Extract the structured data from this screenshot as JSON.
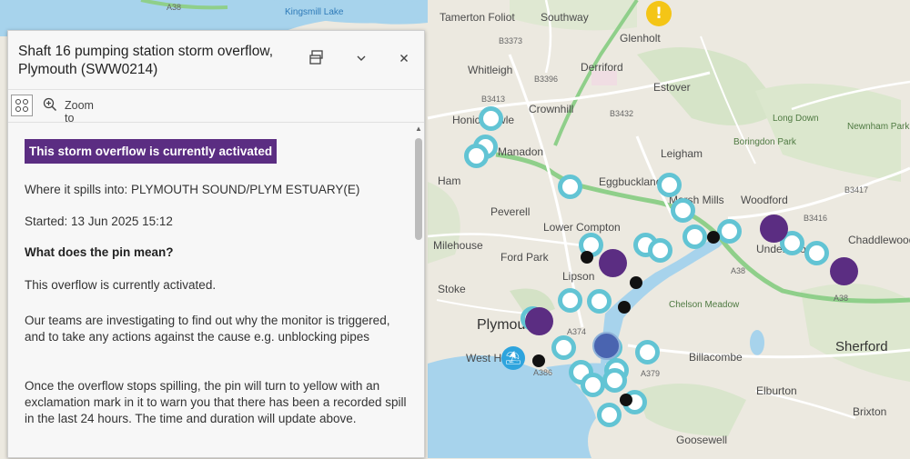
{
  "map": {
    "places": [
      {
        "key": "tamerton",
        "text": "Tamerton Foliot"
      },
      {
        "key": "southway",
        "text": "Southway"
      },
      {
        "key": "glenholt",
        "text": "Glenholt"
      },
      {
        "key": "whitleigh",
        "text": "Whitleigh"
      },
      {
        "key": "derriford",
        "text": "Derriford"
      },
      {
        "key": "estover",
        "text": "Estover"
      },
      {
        "key": "crownhill",
        "text": "Crownhill"
      },
      {
        "key": "honicknowle",
        "text": "Honicknowle"
      },
      {
        "key": "manadon",
        "text": "Manadon"
      },
      {
        "key": "leigham",
        "text": "Leigham"
      },
      {
        "key": "ham",
        "text": "Ham"
      },
      {
        "key": "eggbuckland",
        "text": "Eggbuckland"
      },
      {
        "key": "peverell",
        "text": "Peverell"
      },
      {
        "key": "lower_compton",
        "text": "Lower Compton"
      },
      {
        "key": "marsh_mills",
        "text": "Marsh Mills"
      },
      {
        "key": "woodford",
        "text": "Woodford"
      },
      {
        "key": "milehouse",
        "text": "Milehouse"
      },
      {
        "key": "ford_park",
        "text": "Ford Park"
      },
      {
        "key": "lipson",
        "text": "Lipson"
      },
      {
        "key": "underwood",
        "text": "Underwood"
      },
      {
        "key": "chaddlewood",
        "text": "Chaddlewood"
      },
      {
        "key": "stoke",
        "text": "Stoke"
      },
      {
        "key": "billacombe",
        "text": "Billacombe"
      },
      {
        "key": "sherford",
        "text": "Sherford"
      },
      {
        "key": "elburton",
        "text": "Elburton"
      },
      {
        "key": "brixton",
        "text": "Brixton"
      },
      {
        "key": "goosewell",
        "text": "Goosewell"
      },
      {
        "key": "plymouth",
        "text": "Plymouth"
      },
      {
        "key": "west_hoe",
        "text": "West Hoe"
      },
      {
        "key": "boringdon",
        "text": "Boringdon Park"
      },
      {
        "key": "long_down",
        "text": "Long Down"
      },
      {
        "key": "newnham",
        "text": "Newnham Park"
      },
      {
        "key": "chelson",
        "text": "Chelson Meadow"
      },
      {
        "key": "kingsmill",
        "text": "Kingsmill Lake"
      },
      {
        "key": "a38_nw",
        "text": "A38"
      },
      {
        "key": "a38_e1",
        "text": "A38"
      },
      {
        "key": "a38_e2",
        "text": "A38"
      },
      {
        "key": "b3373",
        "text": "B3373"
      },
      {
        "key": "b3413",
        "text": "B3413"
      },
      {
        "key": "b3432",
        "text": "B3432"
      },
      {
        "key": "b3396",
        "text": "B3396"
      },
      {
        "key": "b3416",
        "text": "B3416"
      },
      {
        "key": "b3417",
        "text": "B3417"
      },
      {
        "key": "a374",
        "text": "A374"
      },
      {
        "key": "a379",
        "text": "A379"
      },
      {
        "key": "a386",
        "text": "A386"
      }
    ],
    "marker_colors": {
      "teal": "#62c4d4",
      "purple": "#5b2d82",
      "black": "#111111",
      "yellow": "#f4c516",
      "blue": "#4a64b0"
    },
    "markers": [
      {
        "type": "warning",
        "icon": "exclamation-icon",
        "glyph": "!"
      },
      {
        "type": "beach",
        "icon": "beach-umbrella-icon",
        "glyph": "⛱"
      }
    ]
  },
  "panel": {
    "title": "Shaft 16 pumping station storm overflow, Plymouth (SWW0214)",
    "toolbar": {
      "zoom_label": "Zoom to"
    },
    "status_badge": "This storm overflow is currently activated",
    "spills_into": "Where it spills into: PLYMOUTH SOUND/PLYM ESTUARY(E)",
    "started": "Started: 13 Jun 2025 15:12",
    "pin_heading": "What does the pin mean?",
    "pin_status": "This overflow is currently activated.",
    "investigating": "Our teams are investigating to find out why the monitor is triggered, and to take any actions against the cause e.g. unblocking pipes",
    "once_stops": "Once the overflow stops spilling, the pin will turn to yellow with an exclamation mark in it to warn you that there has been a recorded spill in the last 24 hours. The time and duration will update above."
  }
}
